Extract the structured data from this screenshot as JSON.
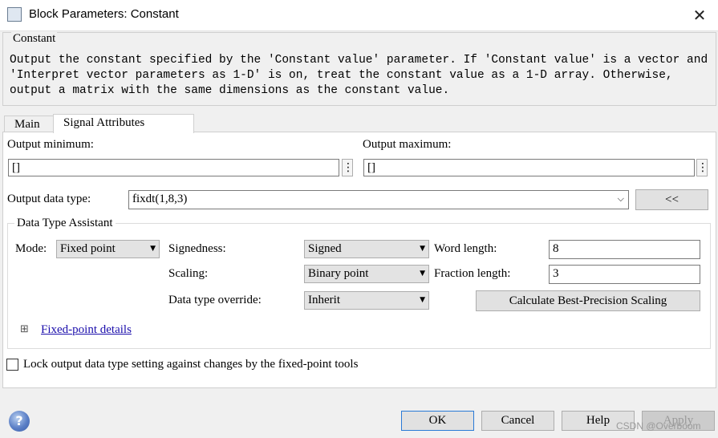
{
  "window": {
    "title": "Block Parameters: Constant",
    "close_glyph": "✕",
    "app_icon": "simulink-block-icon"
  },
  "group": {
    "label": "Constant",
    "description": "Output the constant specified by the 'Constant value' parameter. If 'Constant value' is a vector and 'Interpret vector parameters as 1-D' is on, treat the constant value as a 1-D array. Otherwise, output a matrix with the same dimensions as the constant value."
  },
  "tabs": [
    {
      "label": "Main"
    },
    {
      "label": "Signal Attributes"
    }
  ],
  "signal_attributes": {
    "output_minimum_label": "Output minimum:",
    "output_minimum_value": "[]",
    "output_maximum_label": "Output maximum:",
    "output_maximum_value": "[]",
    "dots": "⋮",
    "output_data_type_label": "Output data type:",
    "output_data_type_value": "fixdt(1,8,3)",
    "assistant_toggle_label": "<<",
    "dta": {
      "title": "Data Type Assistant",
      "mode_label": "Mode:",
      "mode_value": "Fixed point",
      "signedness_label": "Signedness:",
      "signedness_value": "Signed",
      "word_length_label": "Word length:",
      "word_length_value": "8",
      "scaling_label": "Scaling:",
      "scaling_value": "Binary point",
      "fraction_length_label": "Fraction length:",
      "fraction_length_value": "3",
      "override_label": "Data type override:",
      "override_value": "Inherit",
      "calc_button": "Calculate Best-Precision Scaling",
      "expand_glyph": "⊞",
      "fixed_point_details": "Fixed-point details"
    },
    "lock_checkbox_label": "Lock output data type setting against changes by the fixed-point tools",
    "lock_checked": false
  },
  "buttons": {
    "ok": "OK",
    "cancel": "Cancel",
    "help": "Help",
    "apply": "Apply"
  },
  "help_glyph": "?",
  "watermark": "CSDN @Overboom"
}
